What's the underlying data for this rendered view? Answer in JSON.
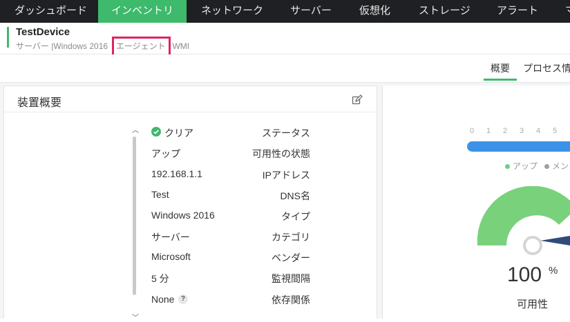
{
  "nav": {
    "items": [
      {
        "label": "ダッシュボード",
        "active": false
      },
      {
        "label": "インベントリ",
        "active": true
      },
      {
        "label": "ネットワーク",
        "active": false
      },
      {
        "label": "サーバー",
        "active": false
      },
      {
        "label": "仮想化",
        "active": false
      },
      {
        "label": "ストレージ",
        "active": false
      },
      {
        "label": "アラート",
        "active": false
      },
      {
        "label": "マ",
        "active": false
      }
    ]
  },
  "device": {
    "name": "TestDevice",
    "meta_type": "サーバー",
    "meta_os": "Windows 2016",
    "meta_agent": "エージェント",
    "meta_protocol": "WMI",
    "separator": "|"
  },
  "tabs": [
    {
      "label": "概要",
      "active": true
    },
    {
      "label": "プロセス情",
      "active": false
    }
  ],
  "summary": {
    "title": "装置概要",
    "rows": [
      {
        "label": "ステータス",
        "value": "クリア"
      },
      {
        "label": "可用性の状態",
        "value": "アップ"
      },
      {
        "label": "IPアドレス",
        "value": "192.168.1.1"
      },
      {
        "label": "DNS名",
        "value": "Test"
      },
      {
        "label": "タイプ",
        "value": "Windows 2016"
      },
      {
        "label": "カテゴリ",
        "value": "サーバー"
      },
      {
        "label": "ベンダー",
        "value": "Microsoft"
      },
      {
        "label": "監視間隔",
        "value": "5 分"
      },
      {
        "label": "依存関係",
        "value": "None"
      }
    ],
    "help_icon": "?"
  },
  "availability": {
    "ticks": [
      "0",
      "1",
      "2",
      "3",
      "4",
      "5"
    ],
    "legend": [
      {
        "label": "アップ",
        "color": "#6fcf7f"
      },
      {
        "label": "メン",
        "color": "#9e9e9e"
      }
    ],
    "bar_color": "#3b92e6",
    "gauge_color": "#79d17c",
    "percent": "100",
    "unit": "%",
    "label": "可用性"
  },
  "colors": {
    "accent": "#3dba6b",
    "highlight": "#e0245e",
    "nav_bg": "#1e2023"
  }
}
